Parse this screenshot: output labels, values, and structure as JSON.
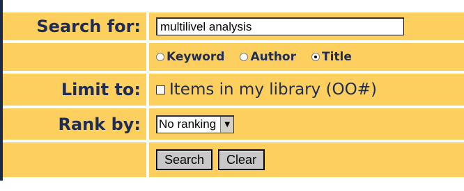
{
  "form": {
    "search_label": "Search for:",
    "search_value": "multilivel analysis",
    "search_options": [
      {
        "label": "Keyword",
        "selected": false
      },
      {
        "label": "Author",
        "selected": false
      },
      {
        "label": "Title",
        "selected": true
      }
    ],
    "limit_label": "Limit to:",
    "limit_checkbox_label": "Items in my library (OO#)",
    "limit_checked": false,
    "rank_label": "Rank by:",
    "rank_value": "No ranking",
    "search_button": "Search",
    "clear_button": "Clear"
  },
  "colors": {
    "cell_background": "#fccf5e",
    "label_text": "#1f2d54",
    "left_border": "#1a2a4a"
  }
}
